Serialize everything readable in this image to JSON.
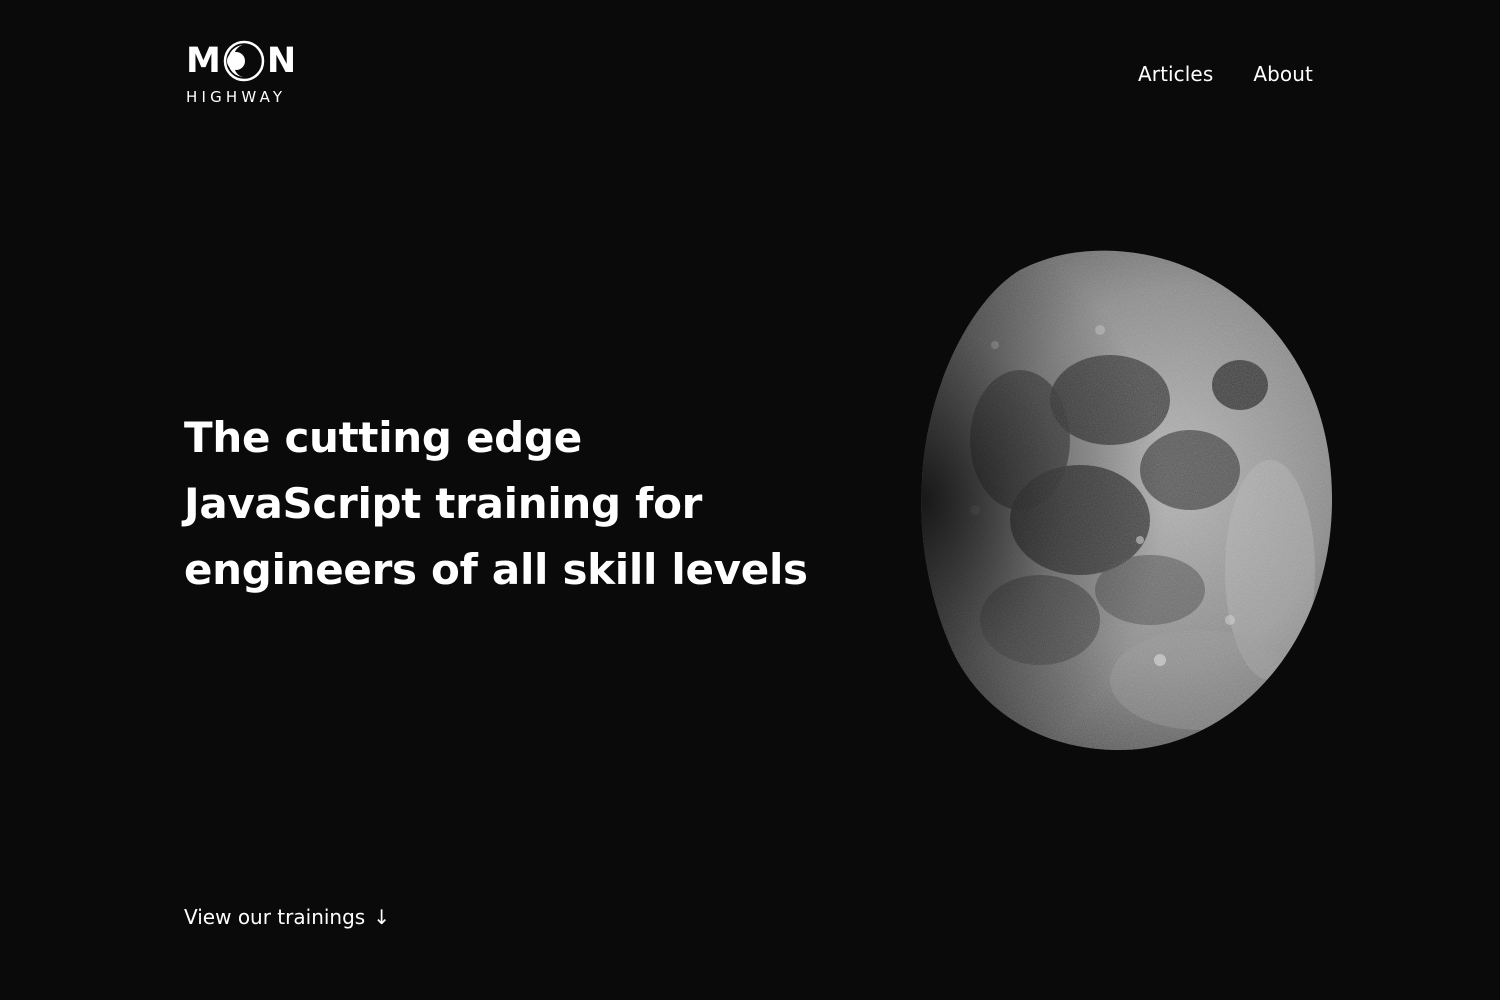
{
  "brand": {
    "logo_letter_1": "M",
    "logo_letter_2": "N",
    "logo_sub": "HIGHWAY"
  },
  "nav": {
    "items": [
      {
        "label": "Articles"
      },
      {
        "label": "About"
      }
    ]
  },
  "hero": {
    "headline_lines": [
      "The cutting edge",
      "JavaScript training for",
      "engineers of all skill levels"
    ]
  },
  "cta": {
    "label": "View our trainings",
    "icon": "arrow-down-icon",
    "glyph": "↓"
  },
  "colors": {
    "background": "#0a0a0a",
    "text": "#ffffff"
  }
}
